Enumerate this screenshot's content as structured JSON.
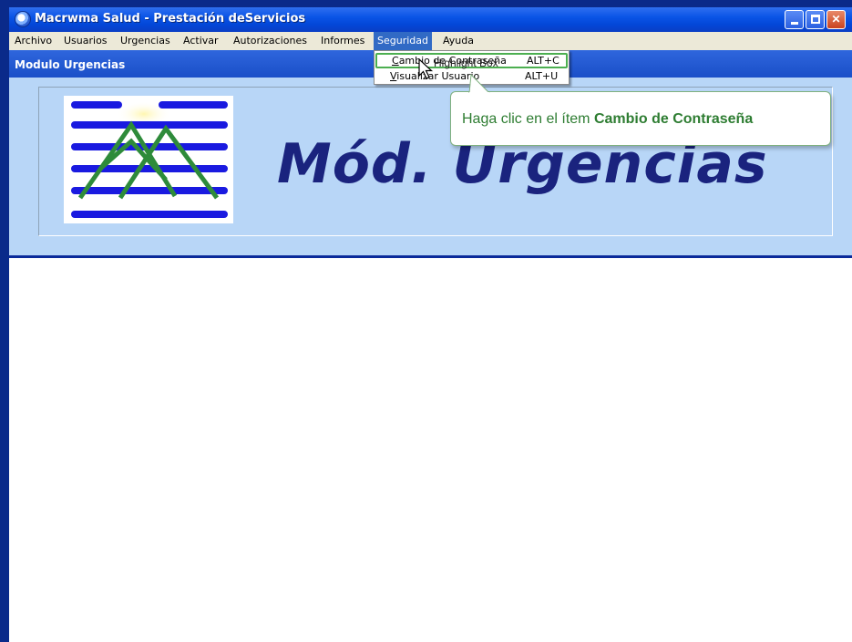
{
  "window": {
    "title": "Macrwma Salud - Prestación deServicios",
    "controls": {
      "minimize": "minimize",
      "maximize": "maximize",
      "close": "close"
    }
  },
  "menubar": {
    "items": [
      {
        "label": "Archivo"
      },
      {
        "label": "Usuarios"
      },
      {
        "label": "Urgencias"
      },
      {
        "label": "Activar"
      },
      {
        "label": "Autorizaciones"
      },
      {
        "label": "Informes"
      },
      {
        "label": "Seguridad",
        "active": true
      },
      {
        "label": "Ayuda"
      }
    ]
  },
  "module": {
    "title": "Modulo Urgencias"
  },
  "banner": {
    "heading": "Mód. Urgencias"
  },
  "dropdown": {
    "items": [
      {
        "label_pre": "",
        "label_ul": "C",
        "label_post": "ambio de Contraseña",
        "shortcut": "ALT+C",
        "highlighted": true
      },
      {
        "label_pre": "",
        "label_ul": "V",
        "label_post": "isualizar Usuario",
        "shortcut": "ALT+U"
      }
    ],
    "highlight_label": "Highlight Box"
  },
  "callout": {
    "text_prefix": "Haga clic en el ítem ",
    "text_emphasis": "Cambio de Contraseña"
  },
  "colors": {
    "titlebar": "#0a54e6",
    "menubar": "#ece9d8",
    "banner_bg": "#b8d6f7",
    "banner_heading": "#1a237e",
    "callout_text": "#2e7d32",
    "highlight_border": "#4caf50"
  }
}
